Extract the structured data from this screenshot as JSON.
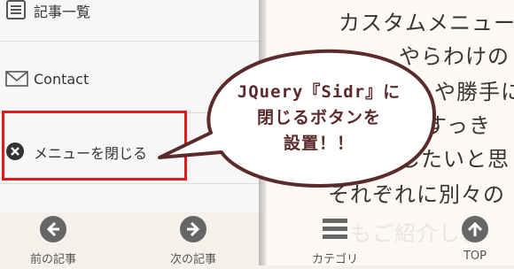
{
  "article": {
    "lines": [
      "カスタムメニュー",
      "やらわけの",
      "や勝手に",
      "、すっき",
      "したいと思",
      "それぞれに別々の",
      "もご紹介しま"
    ]
  },
  "menu": {
    "items": [
      {
        "label": "記事一覧",
        "icon": "list-icon"
      },
      {
        "label": "Contact",
        "icon": "mail-icon"
      },
      {
        "label": "メニューを閉じる",
        "icon": "close-circle-icon"
      }
    ]
  },
  "callout": {
    "lines": [
      "JQuery『Sidr』に",
      "閉じるボタンを",
      "設置！！"
    ]
  },
  "bottom_nav": {
    "prev": "前の記事",
    "next": "次の記事",
    "categories": "カテゴリ",
    "top": "TOP"
  },
  "colors": {
    "highlight": "#e21a1a",
    "callout_border": "#5b2a2a",
    "icon_gray": "#666666"
  }
}
